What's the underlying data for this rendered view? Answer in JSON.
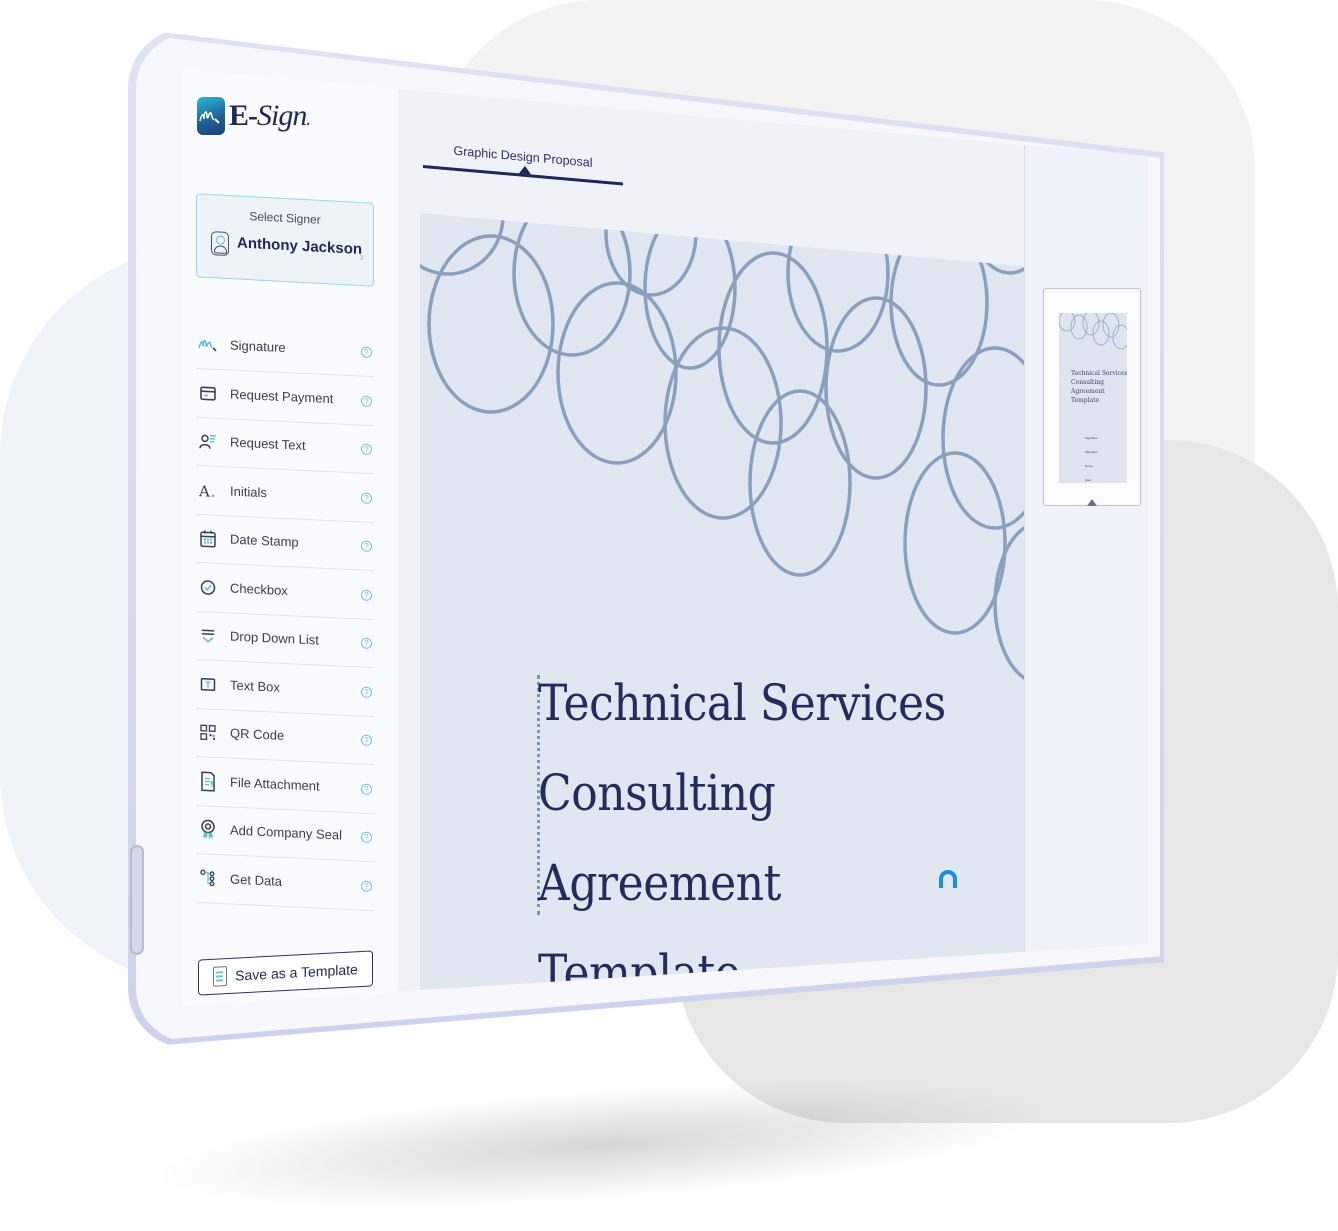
{
  "app": {
    "brand": "E-Sign",
    "brand_prefix": "E-",
    "brand_suffix": "Sign",
    "brand_mark": "."
  },
  "signer": {
    "label": "Select Signer",
    "name": "Anthony Jackson",
    "chevron": "›"
  },
  "tools": [
    {
      "label": "Signature",
      "icon": "signature-icon"
    },
    {
      "label": "Request Payment",
      "icon": "credit-card-icon"
    },
    {
      "label": "Request Text",
      "icon": "user-text-icon"
    },
    {
      "label": "Initials",
      "icon": "initials-icon"
    },
    {
      "label": "Date Stamp",
      "icon": "calendar-icon"
    },
    {
      "label": "Checkbox",
      "icon": "checkbox-icon"
    },
    {
      "label": "Drop Down List",
      "icon": "dropdown-icon"
    },
    {
      "label": "Text Box",
      "icon": "text-box-icon"
    },
    {
      "label": "QR Code",
      "icon": "qr-code-icon"
    },
    {
      "label": "File Attachment",
      "icon": "file-attachment-icon"
    },
    {
      "label": "Add Company Seal",
      "icon": "seal-icon"
    },
    {
      "label": "Get Data",
      "icon": "data-icon"
    }
  ],
  "help_glyph": "?",
  "save_template_label": "Save as a Template",
  "document": {
    "tab_label": "Graphic Design Proposal",
    "title_lines": [
      "Technical Services",
      "Consulting Agreement",
      "Template"
    ]
  },
  "thumbnail": {
    "title": "Technical Services Consulting Agreement Template",
    "fields": [
      "Signature",
      "Signature",
      "Name",
      "Date"
    ]
  },
  "colors": {
    "brand_navy": "#1f2858",
    "accent_cyan": "#6cc5df",
    "ring_color": "#8aa1bd",
    "page_bg": "#e1e7f0",
    "help_widget": "#1a8fe0"
  }
}
